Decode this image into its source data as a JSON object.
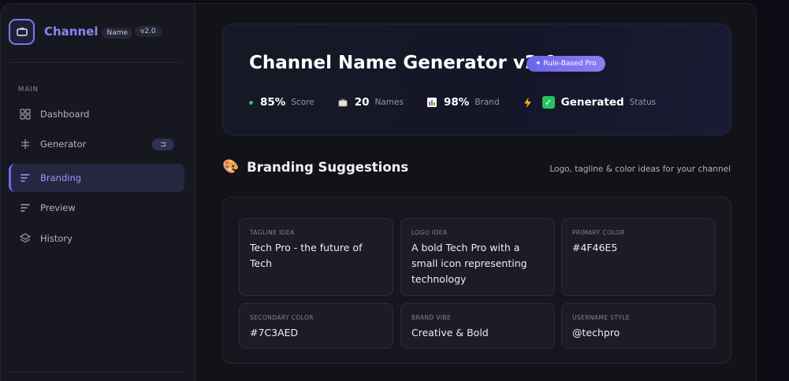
{
  "brand": {
    "name": "Channel",
    "sub": "Name",
    "version": "v2.0"
  },
  "sidebar": {
    "section": "MAIN",
    "items": [
      {
        "label": "Dashboard",
        "icon": "grid-icon"
      },
      {
        "label": "Generator",
        "icon": "sliders-icon",
        "badge": "⊐"
      },
      {
        "label": "Branding",
        "icon": "lines-icon",
        "active": true
      },
      {
        "label": "Preview",
        "icon": "lines-icon"
      },
      {
        "label": "History",
        "icon": "layers-icon"
      }
    ]
  },
  "hero": {
    "title": "Channel Name Generator v2.0",
    "pill": "✦ Rule-Based Pro",
    "stats": [
      {
        "value": "85%",
        "label": "Score"
      },
      {
        "value": "20",
        "label": "Names"
      },
      {
        "value": "98%",
        "label": "Brand"
      },
      {
        "value": "Generated",
        "label": "Status"
      }
    ]
  },
  "section": {
    "emoji": "🎨",
    "title": "Branding Suggestions",
    "subtitle": "Logo, tagline & color ideas for your channel"
  },
  "cards": [
    {
      "label": "TAGLINE IDEA",
      "value": "Tech Pro - the future of Tech"
    },
    {
      "label": "LOGO IDEA",
      "value": "A bold Tech Pro with a small icon representing technology"
    },
    {
      "label": "PRIMARY COLOR",
      "value": "#4F46E5"
    },
    {
      "label": "SECONDARY COLOR",
      "value": "#7C3AED"
    },
    {
      "label": "BRAND VIBE",
      "value": "Creative & Bold"
    },
    {
      "label": "USERNAME STYLE",
      "value": "@techpro"
    }
  ],
  "colors": {
    "accent": "#6f67ea",
    "success": "#22c55e",
    "background": "#12131b"
  }
}
